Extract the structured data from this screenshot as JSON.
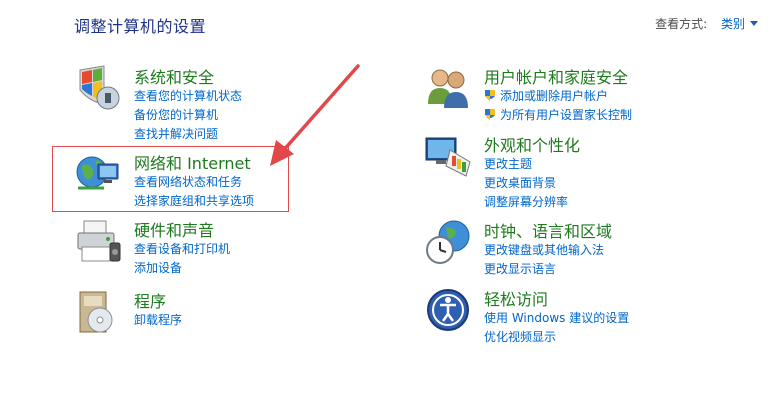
{
  "header": {
    "title": "调整计算机的设置",
    "view_by_label": "查看方式:",
    "view_by_value": "类别"
  },
  "categories": [
    {
      "icon": "security-shield-icon",
      "title": "系统和安全",
      "links": [
        "查看您的计算机状态",
        "备份您的计算机",
        "查找并解决问题"
      ]
    },
    {
      "icon": "network-globe-icon",
      "title": "网络和 Internet",
      "links": [
        "查看网络状态和任务",
        "选择家庭组和共享选项"
      ]
    },
    {
      "icon": "printer-icon",
      "title": "硬件和声音",
      "links": [
        "查看设备和打印机",
        "添加设备"
      ]
    },
    {
      "icon": "programs-box-icon",
      "title": "程序",
      "links": [
        "卸载程序"
      ]
    },
    {
      "icon": "users-icon",
      "title": "用户帐户和家庭安全",
      "links": [
        "添加或删除用户帐户",
        "为所有用户设置家长控制"
      ]
    },
    {
      "icon": "appearance-monitor-icon",
      "title": "外观和个性化",
      "links": [
        "更改主题",
        "更改桌面背景",
        "调整屏幕分辨率"
      ]
    },
    {
      "icon": "clock-globe-icon",
      "title": "时钟、语言和区域",
      "links": [
        "更改键盘或其他输入法",
        "更改显示语言"
      ]
    },
    {
      "icon": "ease-of-access-icon",
      "title": "轻松访问",
      "links": [
        "使用 Windows 建议的设置",
        "优化视频显示"
      ]
    }
  ],
  "annotation_color": "#e0484a"
}
